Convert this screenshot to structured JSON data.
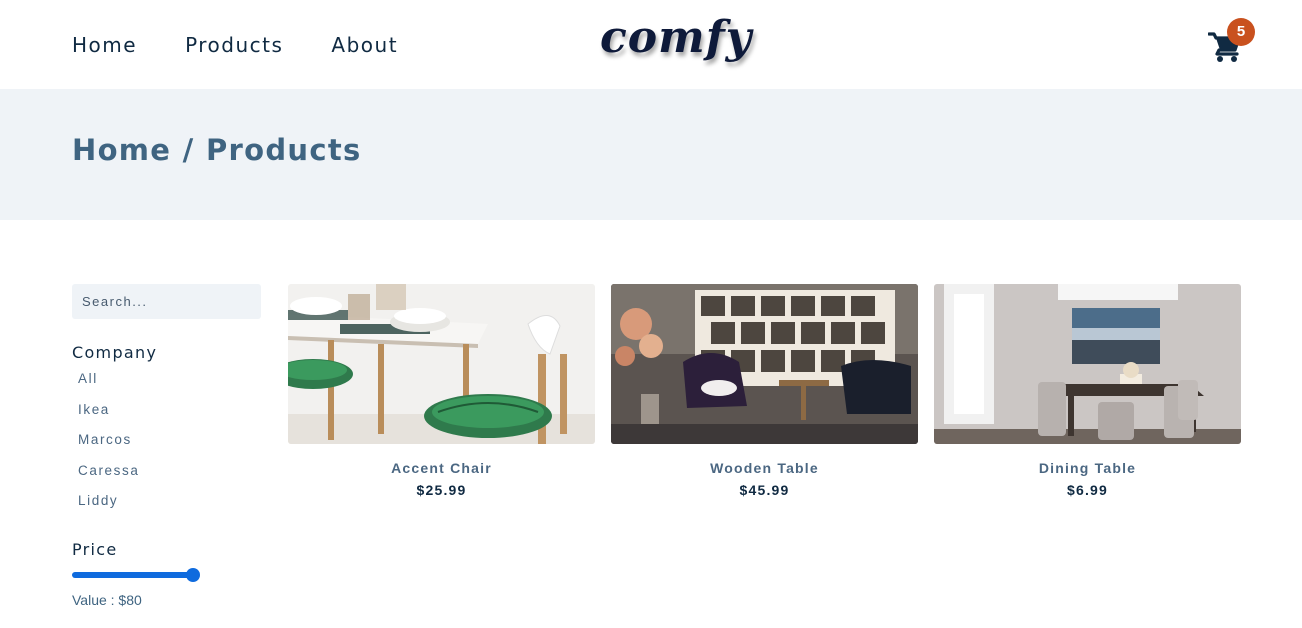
{
  "nav": {
    "links": [
      "Home",
      "Products",
      "About"
    ],
    "logo": "comfy",
    "cart_count": "5"
  },
  "hero": {
    "title": "Home / Products"
  },
  "filters": {
    "search_placeholder": "Search...",
    "company_heading": "Company",
    "companies": [
      "All",
      "Ikea",
      "Marcos",
      "Caressa",
      "Liddy"
    ],
    "price_heading": "Price",
    "price_value_text": "Value : $80",
    "price_slider_fraction": 1.0
  },
  "products": [
    {
      "name": "Accent Chair",
      "price": "$25.99"
    },
    {
      "name": "Wooden Table",
      "price": "$45.99"
    },
    {
      "name": "Dining Table",
      "price": "$6.99"
    }
  ],
  "colors": {
    "primary_text": "#102a42",
    "secondary_text": "#4b6782",
    "hero_bg": "#eff3f7",
    "accent_blue": "#0f6bde",
    "badge": "#c9511e"
  }
}
